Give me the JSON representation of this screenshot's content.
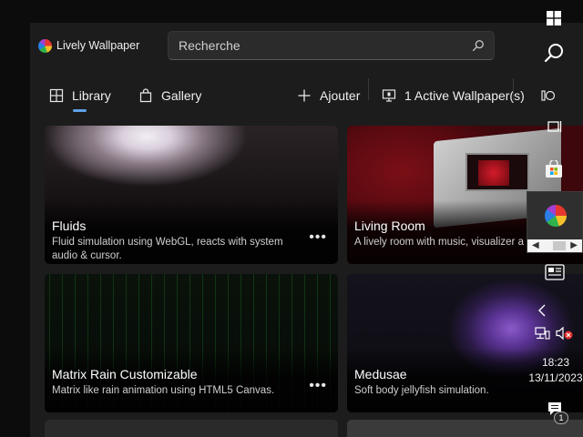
{
  "app": {
    "title": "Lively Wallpaper",
    "search_placeholder": "Recherche"
  },
  "nav": {
    "library": "Library",
    "gallery": "Gallery",
    "add": "Ajouter",
    "active": "1 Active Wallpaper(s)"
  },
  "cards": [
    {
      "title": "Fluids",
      "desc": "Fluid simulation using WebGL, reacts with system audio & cursor.",
      "more": "•••"
    },
    {
      "title": "Living Room",
      "desc": "A lively room with music, visualizer a"
    },
    {
      "title": "Matrix Rain Customizable",
      "desc": "Matrix like rain animation using HTML5 Canvas.",
      "more": "•••"
    },
    {
      "title": "Medusae",
      "desc": "Soft body jellyfish simulation."
    }
  ],
  "taskbar": {
    "time": "18:23",
    "date": "13/11/2023",
    "notifications": "1"
  },
  "colors": {
    "accent": "#4f8ed6",
    "window_bg": "#1c1c1c"
  }
}
